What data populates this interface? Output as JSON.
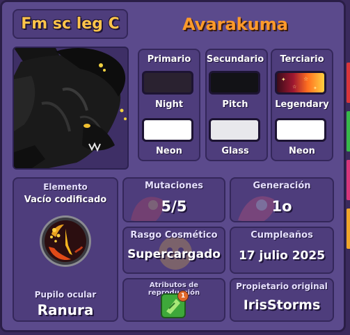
{
  "header": {
    "nickname": "Fm sc leg C",
    "species": "Avarakuma"
  },
  "colors": {
    "primary": {
      "header": "Primario",
      "top": {
        "label": "Night",
        "hex": "#2a2230"
      },
      "bottom": {
        "label": "Neon",
        "hex": "#ffffff"
      }
    },
    "secondary": {
      "header": "Secundario",
      "top": {
        "label": "Pitch",
        "hex": "#121216"
      },
      "bottom": {
        "label": "Glass",
        "hex": "#e8e8ec"
      }
    },
    "tertiary": {
      "header": "Terciario",
      "top": {
        "label": "Legendary",
        "hex": "#ffb020"
      },
      "bottom": {
        "label": "Neon",
        "hex": "#ffffff"
      }
    }
  },
  "element": {
    "title": "Elemento",
    "value": "Vacío codificado",
    "eye_title": "Pupilo ocular",
    "eye_value": "Ranura"
  },
  "mutations": {
    "title": "Mutaciones",
    "value": "5/5"
  },
  "generation": {
    "title": "Generación",
    "value": "1o"
  },
  "cosmetic": {
    "title": "Rasgo Cosmético",
    "value": "Supercargado"
  },
  "birthday": {
    "title": "Cumpleaños",
    "value": "17 julio 2025"
  },
  "breeding": {
    "title": "Atributos de reproducción",
    "badge_count": "1"
  },
  "owner": {
    "title": "Propietario original",
    "value": "IrisStorms"
  },
  "theme": {
    "accent_gold": "#ffc44a",
    "accent_orange": "#ff9a2a",
    "panel": "#4e3d7c",
    "frame": "#5b4a8c"
  }
}
